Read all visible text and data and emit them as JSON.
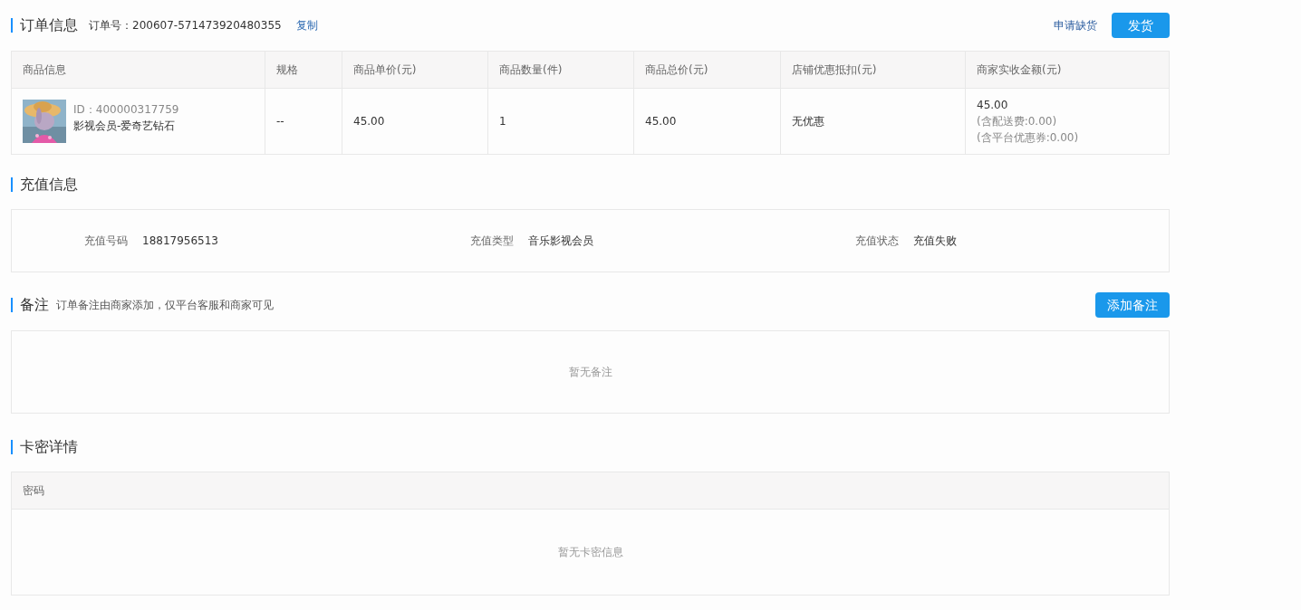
{
  "order_section": {
    "title": "订单信息",
    "order_no_label": "订单号：",
    "order_no": "200607-571473920480355",
    "copy_link": "复制",
    "actions": [
      {
        "kind": "link",
        "label": "申请缺货"
      },
      {
        "kind": "primary",
        "label": "发货"
      }
    ]
  },
  "order_table": {
    "columns": [
      "商品信息",
      "规格",
      "商品单价(元)",
      "商品数量(件)",
      "商品总价(元)",
      "店铺优惠抵扣(元)",
      "商家实收金额(元)"
    ],
    "rows": [
      {
        "product": {
          "kind": "picture",
          "id": "ID：400000317759",
          "name": "影视会员-爱奇艺钻石"
        },
        "spec": "--",
        "unit_price": "45.00",
        "quantity": "1",
        "total": "45.00",
        "discount": "无优惠",
        "received": [
          "45.00",
          "(含配送费:0.00)",
          "(含平台优惠券:0.00)"
        ]
      }
    ]
  },
  "recharge_section": {
    "title": "充值信息",
    "fields": [
      {
        "label": "充值号码",
        "value": "18817956513"
      },
      {
        "label": "充值类型",
        "value": "音乐影视会员"
      },
      {
        "label": "充值状态",
        "value": "充值失败"
      }
    ]
  },
  "remarks_section": {
    "title": "备注",
    "hint": "订单备注由商家添加，仅平台客服和商家可见",
    "add_button": "添加备注",
    "empty_text": "暂无备注"
  },
  "card_section": {
    "title": "卡密详情",
    "columns": [
      "密码"
    ],
    "empty_text": "暂无卡密信息"
  }
}
